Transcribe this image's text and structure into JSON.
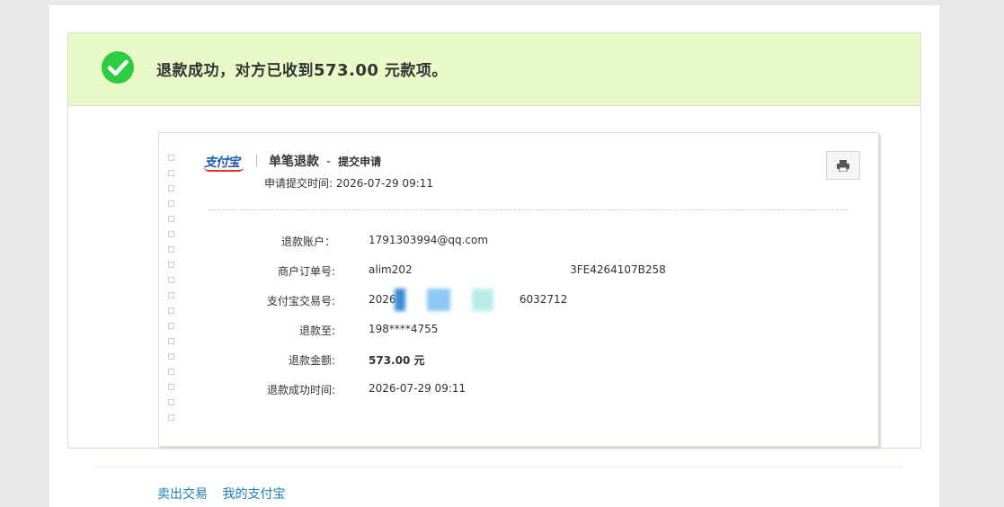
{
  "banner": {
    "prefix": "退款成功，对方已收到",
    "amount": "573.00",
    "suffix": " 元款项。"
  },
  "receipt": {
    "logo_text": "支付宝",
    "title": "单笔退款",
    "dash": "-",
    "subtitle": "提交申请",
    "apply_time_label": "申请提交时间:",
    "apply_time_value": "2026-07-29 09:11",
    "print_icon": "printer-icon",
    "rows": [
      {
        "label": "退款账户：",
        "value": "1791303994@qq.com"
      },
      {
        "label": "商户订单号:",
        "value": "alim202                                              3FE4264107B258"
      },
      {
        "label": "支付宝交易号:",
        "value": "2026                                    6032712"
      },
      {
        "label": "退款至:",
        "value": "198****4755"
      },
      {
        "label": "退款金额:",
        "value": "573.00 元"
      },
      {
        "label": "退款成功时间:",
        "value": "2026-07-29 09:11"
      }
    ]
  },
  "footer": {
    "link1": "卖出交易",
    "link2": "我的支付宝"
  },
  "colors": {
    "success_green": "#2ecc40",
    "banner_bg": "#eaf9c8",
    "link": "#1a7fb5"
  }
}
